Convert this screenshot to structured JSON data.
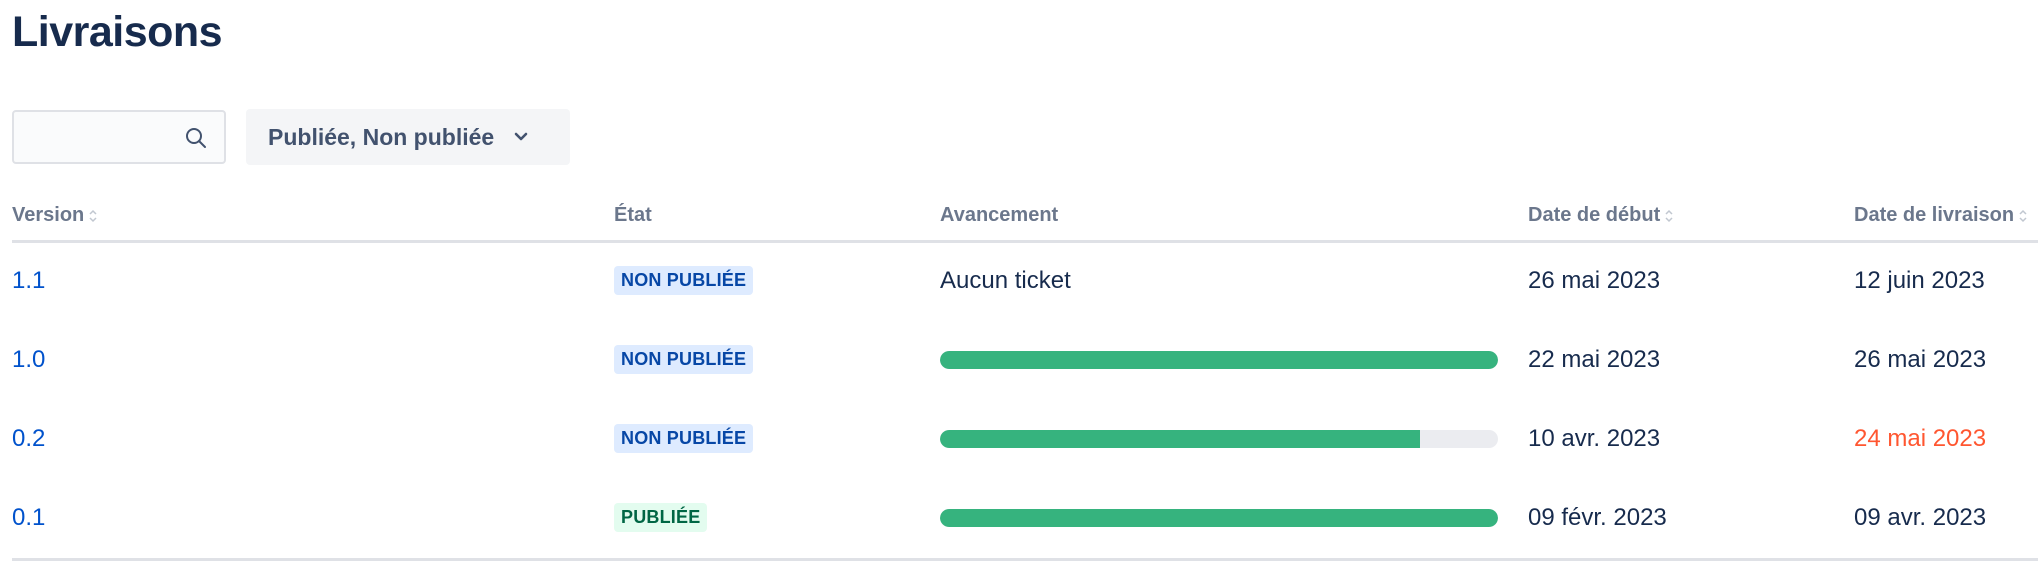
{
  "page": {
    "title": "Livraisons"
  },
  "search": {
    "placeholder": "",
    "value": "",
    "icon": "search-icon"
  },
  "filter": {
    "label": "Publiée, Non publiée",
    "icon": "chevron-down-icon"
  },
  "table": {
    "headers": {
      "version": "Version",
      "status": "État",
      "progress": "Avancement",
      "start_date": "Date de début",
      "release_date": "Date de livraison"
    },
    "rows": [
      {
        "version": "1.1",
        "status": "NON PUBLIÉE",
        "status_kind": "unreleased",
        "progress_text": "Aucun ticket",
        "progress_fraction": null,
        "start_date": "26 mai 2023",
        "release_date": "12 juin 2023",
        "release_late": false
      },
      {
        "version": "1.0",
        "status": "NON PUBLIÉE",
        "status_kind": "unreleased",
        "progress_text": "",
        "progress_fraction": 1.0,
        "start_date": "22 mai 2023",
        "release_date": "26 mai 2023",
        "release_late": false
      },
      {
        "version": "0.2",
        "status": "NON PUBLIÉE",
        "status_kind": "unreleased",
        "progress_text": "",
        "progress_fraction": 0.86,
        "start_date": "10 avr. 2023",
        "release_date": "24 mai 2023",
        "release_late": true
      },
      {
        "version": "0.1",
        "status": "PUBLIÉE",
        "status_kind": "released",
        "progress_text": "",
        "progress_fraction": 1.0,
        "start_date": "09 févr. 2023",
        "release_date": "09 avr. 2023",
        "release_late": false
      }
    ]
  },
  "colors": {
    "progress_done": "#36b37e",
    "progress_track": "#ebecf0",
    "late_date": "#ff5630",
    "link": "#0052cc"
  }
}
